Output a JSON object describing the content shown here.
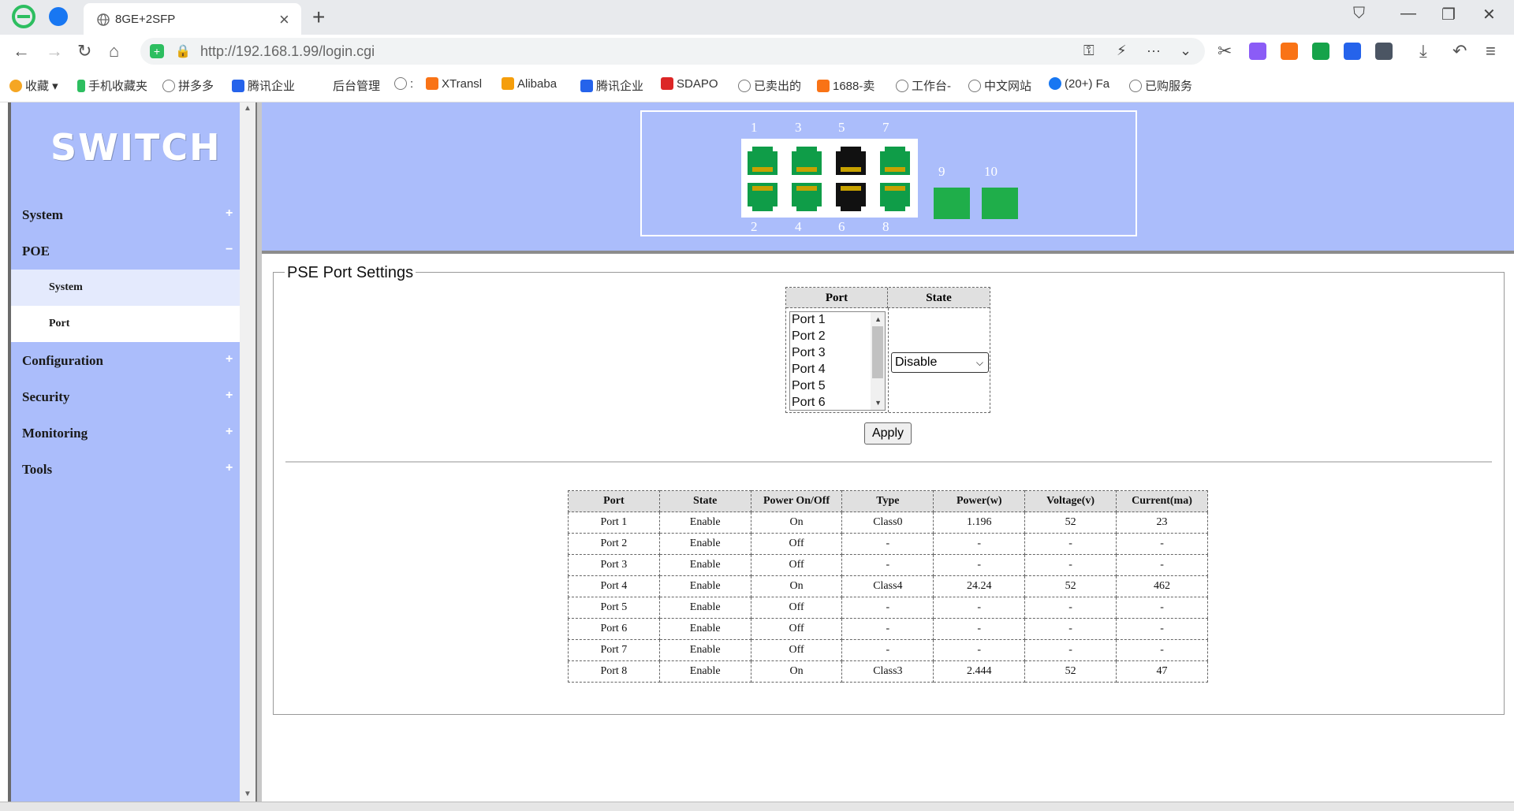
{
  "browser": {
    "tab_title": "8GE+2SFP",
    "url": "http://192.168.1.99/login.cgi",
    "bookmarks": [
      "收藏",
      "手机收藏夹",
      "拼多多",
      "腾讯企业",
      "后台管理",
      ":",
      "XTransl",
      "Alibaba",
      "腾讯企业",
      "SDAPO",
      "已卖出的",
      "1688-卖",
      "工作台-",
      "中文网站",
      "(20+) Fa",
      "已购服务"
    ]
  },
  "sidebar": {
    "brand": "SWITCH",
    "menu": [
      {
        "label": "System",
        "sign": "+"
      },
      {
        "label": "POE",
        "sign": "−"
      },
      {
        "label": "Configuration",
        "sign": "+"
      },
      {
        "label": "Security",
        "sign": "+"
      },
      {
        "label": "Monitoring",
        "sign": "+"
      },
      {
        "label": "Tools",
        "sign": "+"
      }
    ],
    "poe_sub": [
      {
        "label": "System"
      },
      {
        "label": "Port"
      }
    ]
  },
  "ports_panel": {
    "top_numbers": [
      "1",
      "3",
      "5",
      "7"
    ],
    "bottom_numbers": [
      "2",
      "4",
      "6",
      "8"
    ],
    "sfp_numbers": [
      "9",
      "10"
    ],
    "colors": {
      "link_up": "#0f9d48",
      "link_down": "#111111",
      "sfp": "#1fae4a",
      "panel": "#abbdfb"
    }
  },
  "settings": {
    "legend": "PSE Port Settings",
    "col_port": "Port",
    "col_state": "State",
    "port_options": [
      "Port 1",
      "Port 2",
      "Port 3",
      "Port 4",
      "Port 5",
      "Port 6"
    ],
    "state_selected": "Disable",
    "apply_label": "Apply"
  },
  "stats": {
    "headers": [
      "Port",
      "State",
      "Power On/Off",
      "Type",
      "Power(w)",
      "Voltage(v)",
      "Current(ma)"
    ],
    "rows": [
      [
        "Port 1",
        "Enable",
        "On",
        "Class0",
        "1.196",
        "52",
        "23"
      ],
      [
        "Port 2",
        "Enable",
        "Off",
        "-",
        "-",
        "-",
        "-"
      ],
      [
        "Port 3",
        "Enable",
        "Off",
        "-",
        "-",
        "-",
        "-"
      ],
      [
        "Port 4",
        "Enable",
        "On",
        "Class4",
        "24.24",
        "52",
        "462"
      ],
      [
        "Port 5",
        "Enable",
        "Off",
        "-",
        "-",
        "-",
        "-"
      ],
      [
        "Port 6",
        "Enable",
        "Off",
        "-",
        "-",
        "-",
        "-"
      ],
      [
        "Port 7",
        "Enable",
        "Off",
        "-",
        "-",
        "-",
        "-"
      ],
      [
        "Port 8",
        "Enable",
        "On",
        "Class3",
        "2.444",
        "52",
        "47"
      ]
    ]
  }
}
